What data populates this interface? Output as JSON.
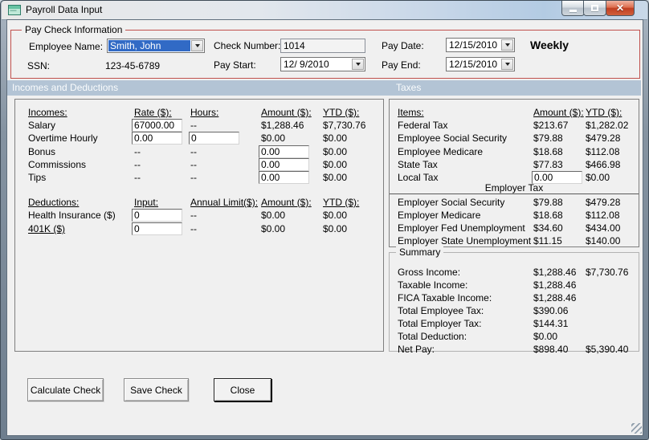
{
  "window": {
    "title": "Payroll Data Input"
  },
  "icons": {
    "close": "✕"
  },
  "paycheck": {
    "group_title": "Pay Check Information",
    "employee_name": {
      "label": "Employee Name:",
      "value": "Smith, John"
    },
    "ssn": {
      "label": "SSN:",
      "value": "123-45-6789"
    },
    "check_number": {
      "label": "Check Number:",
      "value": "1014"
    },
    "pay_start": {
      "label": "Pay Start:",
      "value": "12/ 9/2010"
    },
    "pay_date": {
      "label": "Pay Date:",
      "value": "12/15/2010"
    },
    "pay_end": {
      "label": "Pay End:",
      "value": "12/15/2010"
    },
    "frequency": "Weekly"
  },
  "section_headers": {
    "left": "Incomes and Deductions",
    "right": "Taxes"
  },
  "incomes": {
    "headers": {
      "c0": "Incomes:",
      "c1": "Rate ($):",
      "c2": "Hours:",
      "c3": "Amount ($):",
      "c4": "YTD ($):"
    },
    "rows": [
      {
        "label": "Salary",
        "rate": "67000.00",
        "hours": "--",
        "amount": "$1,288.46",
        "ytd": "$7,730.76"
      },
      {
        "label": "Overtime Hourly",
        "rate": "0.00",
        "hours": "0",
        "amount": "$0.00",
        "ytd": "$0.00"
      },
      {
        "label": "Bonus",
        "rate": "--",
        "hours": "--",
        "amount": "0.00",
        "ytd": "$0.00"
      },
      {
        "label": "Commissions",
        "rate": "--",
        "hours": "--",
        "amount": "0.00",
        "ytd": "$0.00"
      },
      {
        "label": "Tips",
        "rate": "--",
        "hours": "--",
        "amount": "0.00",
        "ytd": "$0.00"
      }
    ]
  },
  "deductions": {
    "headers": {
      "c0": "Deductions:",
      "c1": "Input:",
      "c2": "Annual Limit($):",
      "c3": "Amount ($):",
      "c4": "YTD ($):"
    },
    "rows": [
      {
        "label": "Health Insurance  ($)",
        "input": "0",
        "limit": "--",
        "amount": "$0.00",
        "ytd": "$0.00"
      },
      {
        "label": "401K  ($)",
        "input": "0",
        "limit": "--",
        "amount": "$0.00",
        "ytd": "$0.00"
      }
    ]
  },
  "taxes": {
    "headers": {
      "c0": "Items:",
      "c1": "Amount ($):",
      "c2": "YTD ($):"
    },
    "employee_rows": [
      {
        "label": "Federal Tax",
        "amount": "$213.67",
        "ytd": "$1,282.02"
      },
      {
        "label": "Employee Social Security",
        "amount": "$79.88",
        "ytd": "$479.28"
      },
      {
        "label": "Employee Medicare",
        "amount": "$18.68",
        "ytd": "$112.08"
      },
      {
        "label": "State Tax",
        "amount": "$77.83",
        "ytd": "$466.98"
      },
      {
        "label": "Local Tax",
        "amount": "0.00",
        "ytd": "$0.00"
      }
    ],
    "employer_header": "Employer Tax",
    "employer_rows": [
      {
        "label": "Employer Social Security",
        "amount": "$79.88",
        "ytd": "$479.28"
      },
      {
        "label": "Employer Medicare",
        "amount": "$18.68",
        "ytd": "$112.08"
      },
      {
        "label": "Employer Fed Unemployment",
        "amount": "$34.60",
        "ytd": "$434.00"
      },
      {
        "label": "Employer State Unemployment",
        "amount": "$11.15",
        "ytd": "$140.00"
      }
    ]
  },
  "summary": {
    "group_title": "Summary",
    "rows": [
      {
        "label": "Gross Income:",
        "amount": "$1,288.46",
        "ytd": "$7,730.76"
      },
      {
        "label": "Taxable Income:",
        "amount": "$1,288.46",
        "ytd": ""
      },
      {
        "label": "FICA Taxable Income:",
        "amount": "$1,288.46",
        "ytd": ""
      },
      {
        "label": "Total Employee Tax:",
        "amount": "$390.06",
        "ytd": ""
      },
      {
        "label": "Total Employer Tax:",
        "amount": "$144.31",
        "ytd": ""
      },
      {
        "label": "Total Deduction:",
        "amount": "$0.00",
        "ytd": ""
      },
      {
        "label": "Net Pay:",
        "amount": "$898.40",
        "ytd": "$5,390.40"
      }
    ]
  },
  "buttons": {
    "calculate": "Calculate Check",
    "save": "Save Check",
    "close": "Close"
  },
  "colors": {
    "selection_blue": "#316ac5",
    "groupbox_red": "#c0504d",
    "section_header_bg": "#b3c4d5"
  }
}
